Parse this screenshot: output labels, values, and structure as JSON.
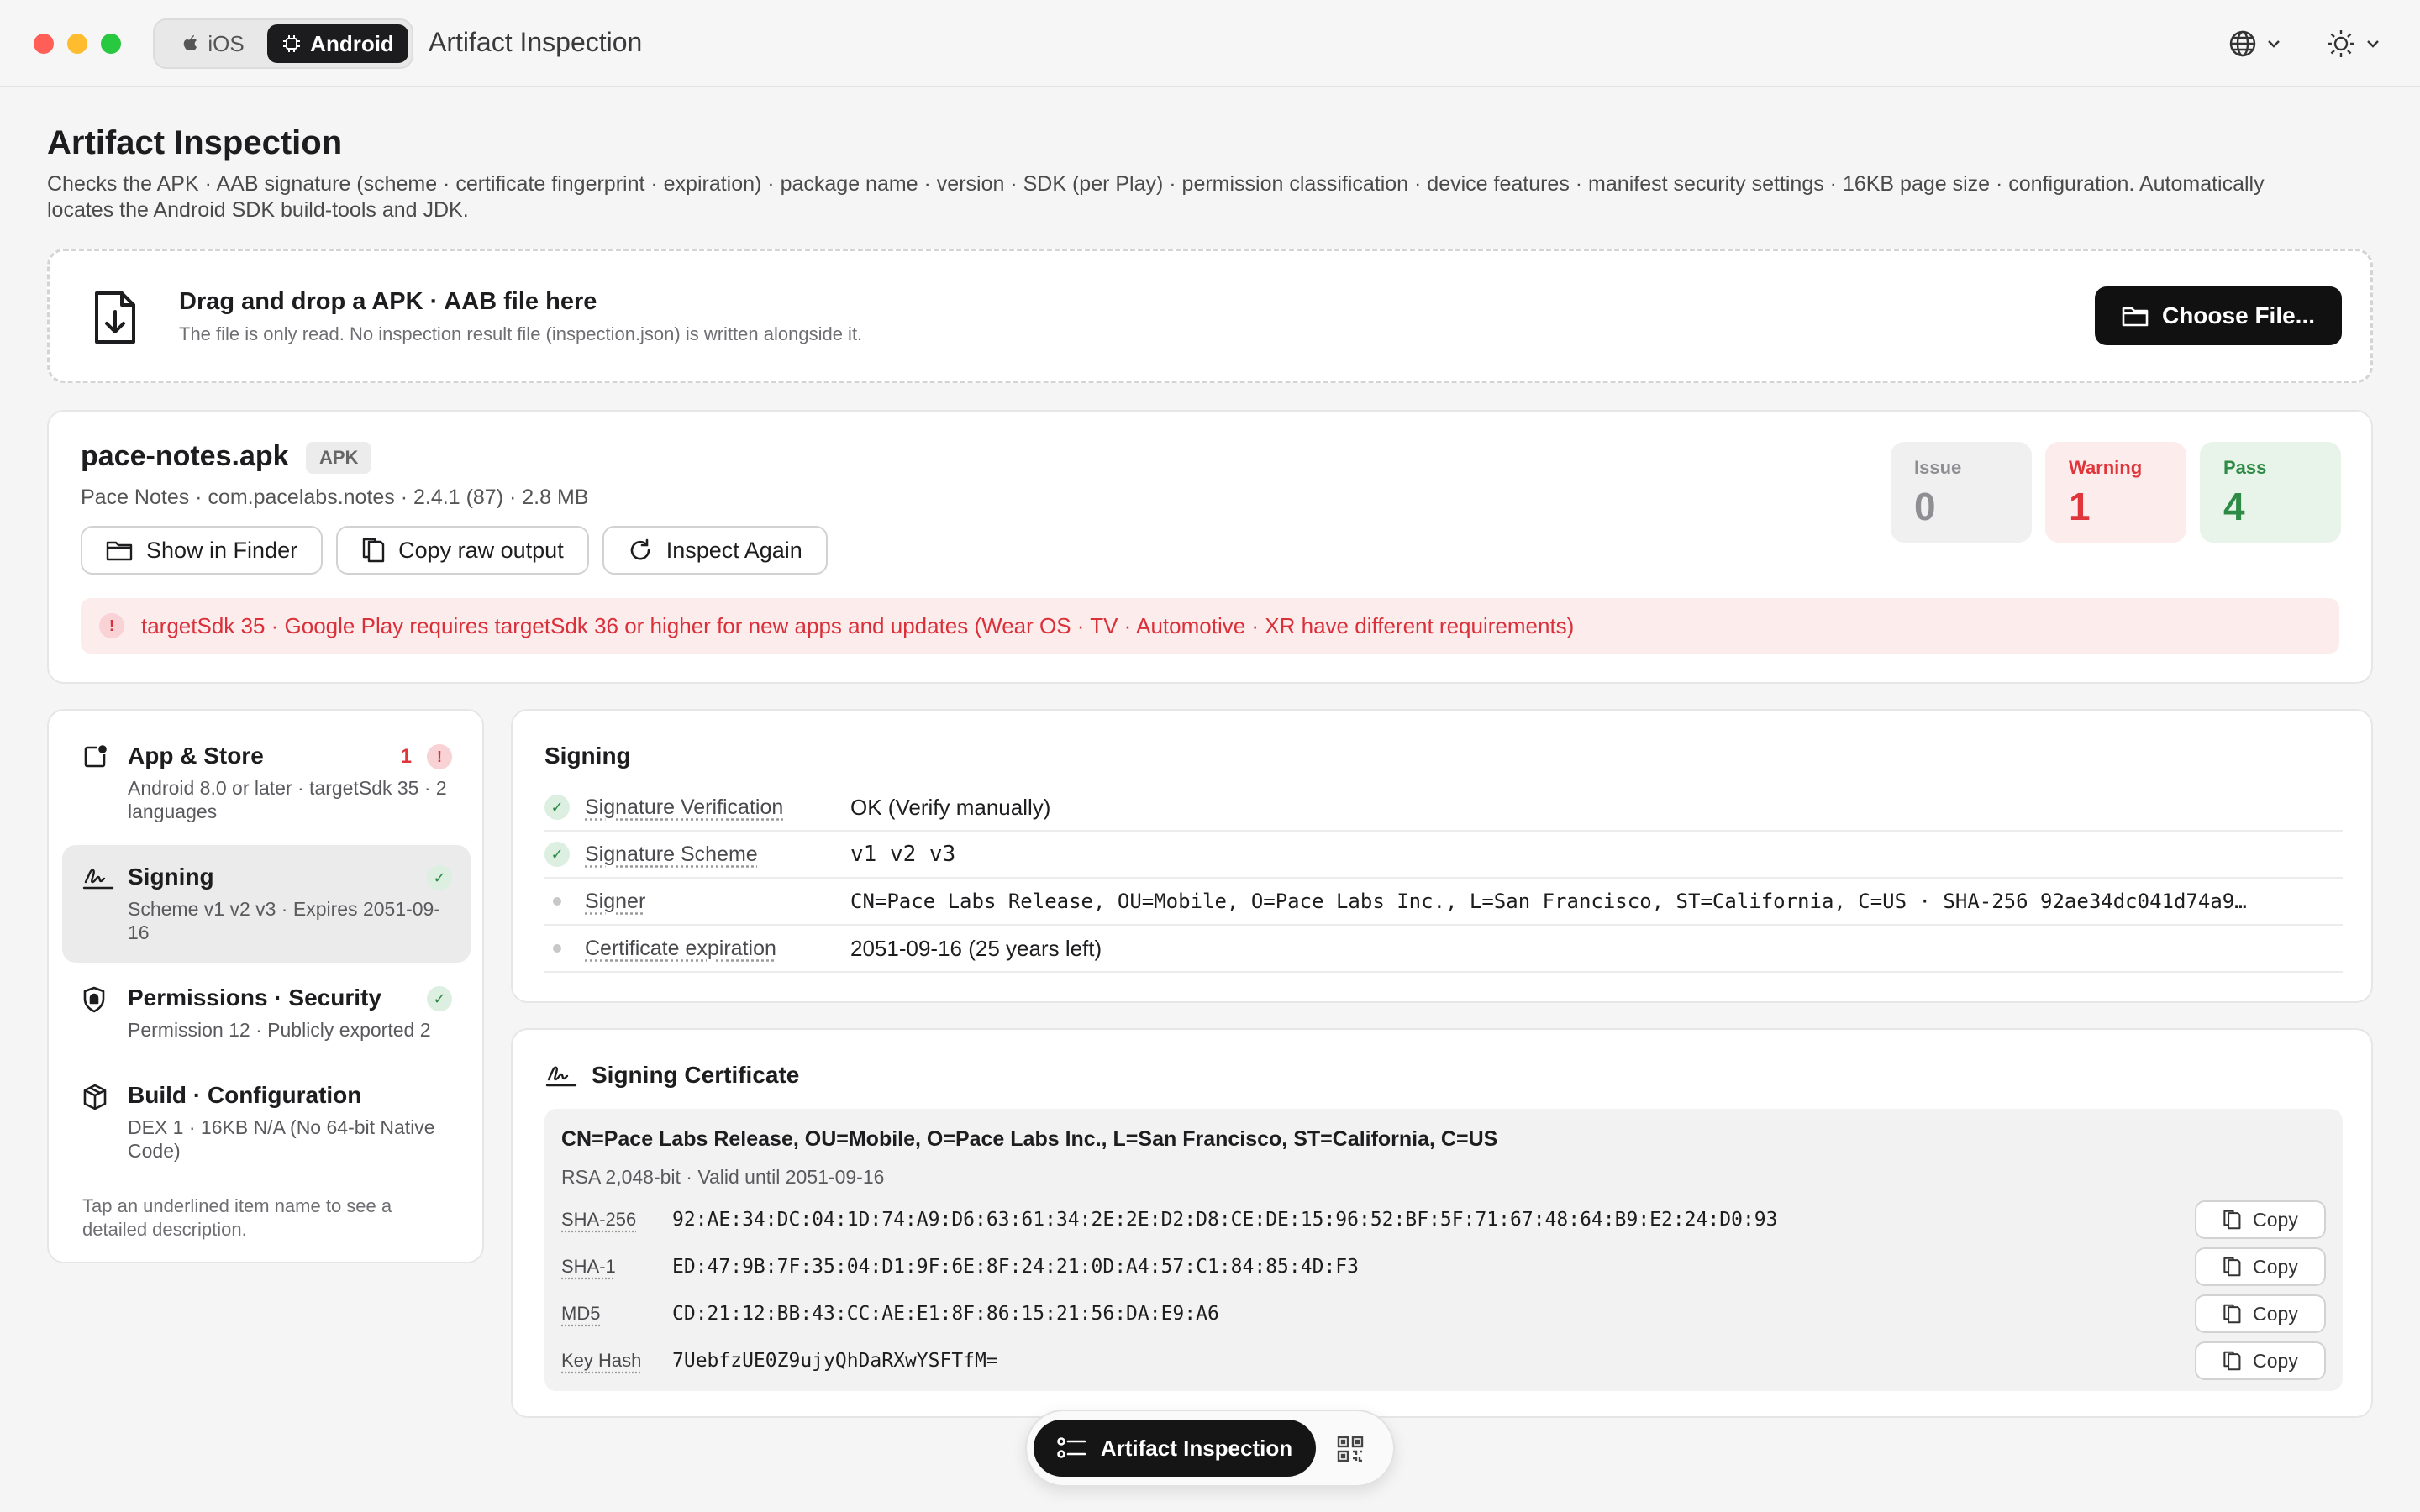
{
  "titlebar": {
    "platform_ios": "iOS",
    "platform_android": "Android",
    "app_title": "Artifact Inspection"
  },
  "header": {
    "title": "Artifact Inspection",
    "description": "Checks the APK · AAB signature (scheme · certificate fingerprint · expiration) · package name · version · SDK (per Play) · permission classification · device features · manifest security settings · 16KB page size · configuration. Automatically locates the Android SDK build-tools and JDK."
  },
  "dropzone": {
    "title": "Drag and drop a APK · AAB file here",
    "subtitle": "The file is only read. No inspection result file (inspection.json) is written alongside it.",
    "choose_label": "Choose File..."
  },
  "file": {
    "name": "pace-notes.apk",
    "type": "APK",
    "meta": "Pace Notes · com.pacelabs.notes · 2.4.1 (87) · 2.8 MB",
    "actions": {
      "show_in_finder": "Show in Finder",
      "copy_raw": "Copy raw output",
      "inspect_again": "Inspect Again"
    },
    "stats": {
      "issue_label": "Issue",
      "issue_value": "0",
      "warning_label": "Warning",
      "warning_value": "1",
      "pass_label": "Pass",
      "pass_value": "4"
    },
    "alert": "targetSdk 35 · Google Play requires targetSdk 36 or higher for new apps and updates (Wear OS · TV · Automotive · XR have different requirements)"
  },
  "sidebar": {
    "items": [
      {
        "title": "App & Store",
        "subtitle": "Android 8.0 or later · targetSdk 35 · 2 languages",
        "count": "1"
      },
      {
        "title": "Signing",
        "subtitle": "Scheme v1 v2 v3 · Expires 2051-09-16"
      },
      {
        "title": "Permissions · Security",
        "subtitle": "Permission 12 · Publicly exported 2"
      },
      {
        "title": "Build · Configuration",
        "subtitle": "DEX 1 · 16KB N/A (No 64-bit Native Code)"
      }
    ],
    "hint": "Tap an underlined item name to see a detailed description."
  },
  "signing": {
    "title": "Signing",
    "rows": [
      {
        "key": "Signature Verification",
        "value": "OK (Verify manually)"
      },
      {
        "key": "Signature Scheme",
        "value": "v1 v2 v3"
      },
      {
        "key": "Signer",
        "value": "CN=Pace Labs Release, OU=Mobile, O=Pace Labs Inc., L=San Francisco, ST=California, C=US · SHA-256 92ae34dc041d74a9…"
      },
      {
        "key": "Certificate expiration",
        "value": "2051-09-16 (25 years left)"
      }
    ]
  },
  "certificate": {
    "title": "Signing Certificate",
    "subject": "CN=Pace Labs Release, OU=Mobile, O=Pace Labs Inc., L=San Francisco, ST=California, C=US",
    "info": "RSA 2,048-bit · Valid until 2051-09-16",
    "copy_label": "Copy",
    "hashes": [
      {
        "key": "SHA-256",
        "value": "92:AE:34:DC:04:1D:74:A9:D6:63:61:34:2E:2E:D2:D8:CE:DE:15:96:52:BF:5F:71:67:48:64:B9:E2:24:D0:93"
      },
      {
        "key": "SHA-1",
        "value": "ED:47:9B:7F:35:04:D1:9F:6E:8F:24:21:0D:A4:57:C1:84:85:4D:F3"
      },
      {
        "key": "MD5",
        "value": "CD:21:12:BB:43:CC:AE:E1:8F:86:15:21:56:DA:E9:A6"
      },
      {
        "key": "Key Hash",
        "value": "7UebfzUE0Z9ujyQhDaRXwYSFTfM="
      }
    ]
  },
  "dock": {
    "label": "Artifact Inspection"
  },
  "colors": {
    "warning": "#e0353a",
    "pass": "#2e8b45",
    "accent_dark": "#111111"
  }
}
